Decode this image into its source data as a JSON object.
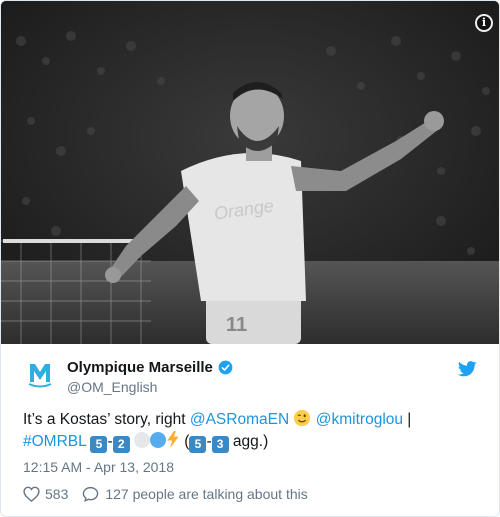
{
  "photo": {
    "alt": "Footballer in white kit celebrating with arm raised",
    "shirt_text": "Orange",
    "info_icon": "info-icon"
  },
  "author": {
    "name": "Olympique Marseille",
    "handle": "@OM_English",
    "avatar_icon": "om-crest-icon",
    "verified_icon": "verified-badge-icon"
  },
  "brand_icon": "twitter-bird-icon",
  "tweet": {
    "part1": "It’s a Kostas’ story, right ",
    "mention1": "@ASRomaEN",
    "mention2": "@kmitroglou",
    "separator": " |",
    "hashtag": "#OMRBL",
    "score_home": "5",
    "score_dash": "-",
    "score_away": "2",
    "agg_open": " (",
    "agg_home": "5",
    "agg_dash": "-",
    "agg_away": "3",
    "agg_close": " agg.)"
  },
  "timestamp": "12:15 AM - Apr 13, 2018",
  "actions": {
    "like_count": "583",
    "reply_text": "127 people are talking about this",
    "like_icon": "heart-icon",
    "reply_icon": "reply-bubble-icon"
  },
  "colors": {
    "link": "#1b95e0",
    "verified": "#1da1f2",
    "keycap": "#3b88c3",
    "muted": "#657786"
  }
}
